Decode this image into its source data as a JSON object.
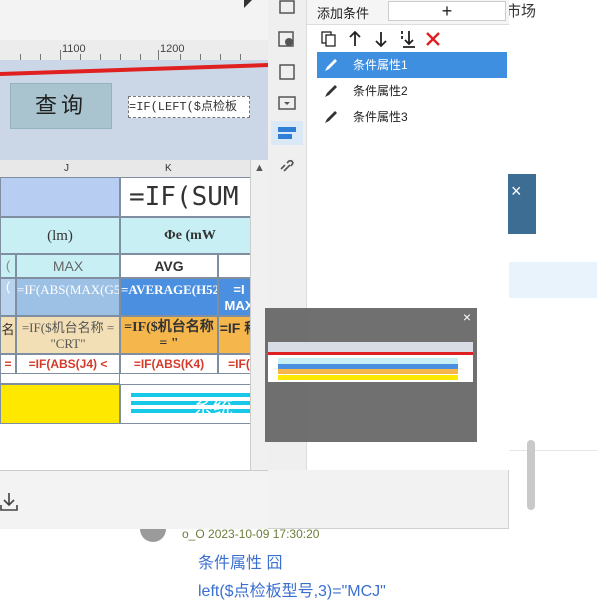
{
  "background_page": {
    "top_right_text": "市场",
    "message": {
      "meta": "o_O 2023-10-09 17:30:20",
      "line1": "条件属性  囧",
      "line2": "left($点检板型号,3)=\"MCJ\""
    }
  },
  "editor": {
    "ruler": {
      "labels": [
        "1100",
        "1200"
      ]
    },
    "query_button": "查询",
    "formula_text": "=IF(LEFT($点检板",
    "column_headers": [
      "J",
      "K"
    ],
    "cells": {
      "big_formula": "=IF(SUM",
      "lm": "(lm)",
      "phi_e": "Φe (mW",
      "row3_left": "(",
      "max": "MAX",
      "avg": "AVG",
      "row4_left": "(",
      "abs_max": "=IF(ABS(MAX(G52))",
      "average": "=AVERAGE(H52)",
      "average_right": "=I MAX",
      "row5_left": "名",
      "machine_name_j": "=IF($机台名称 = \"CRT\"",
      "machine_name_k": "=IF($机台名称 = \"",
      "machine_name_right": "=IF 称",
      "row6_left": "=",
      "abs_j4": "=IF(ABS(J4) <",
      "abs_k4": "=IF(ABS(K4)",
      "abs_right": "=IF(",
      "watermark": "系统"
    }
  },
  "condition_panel": {
    "title": "添加条件",
    "add_button": "+",
    "tools": [
      "copy-icon",
      "arrow-up-icon",
      "arrow-down-icon",
      "move-bottom-icon",
      "delete-icon"
    ],
    "items": [
      {
        "label": "条件属性1",
        "selected": true
      },
      {
        "label": "条件属性2",
        "selected": false
      },
      {
        "label": "条件属性3",
        "selected": false
      }
    ]
  },
  "preview": {
    "close": "×"
  },
  "dialog": {
    "close": "×"
  },
  "colors": {
    "selected": "#3f8fe0",
    "header_blue": "#b7cdf2",
    "cyan": "#c8f0f4",
    "orange": "#f5b64c",
    "yellow": "#ffe800",
    "red_text": "#d43a2a"
  }
}
